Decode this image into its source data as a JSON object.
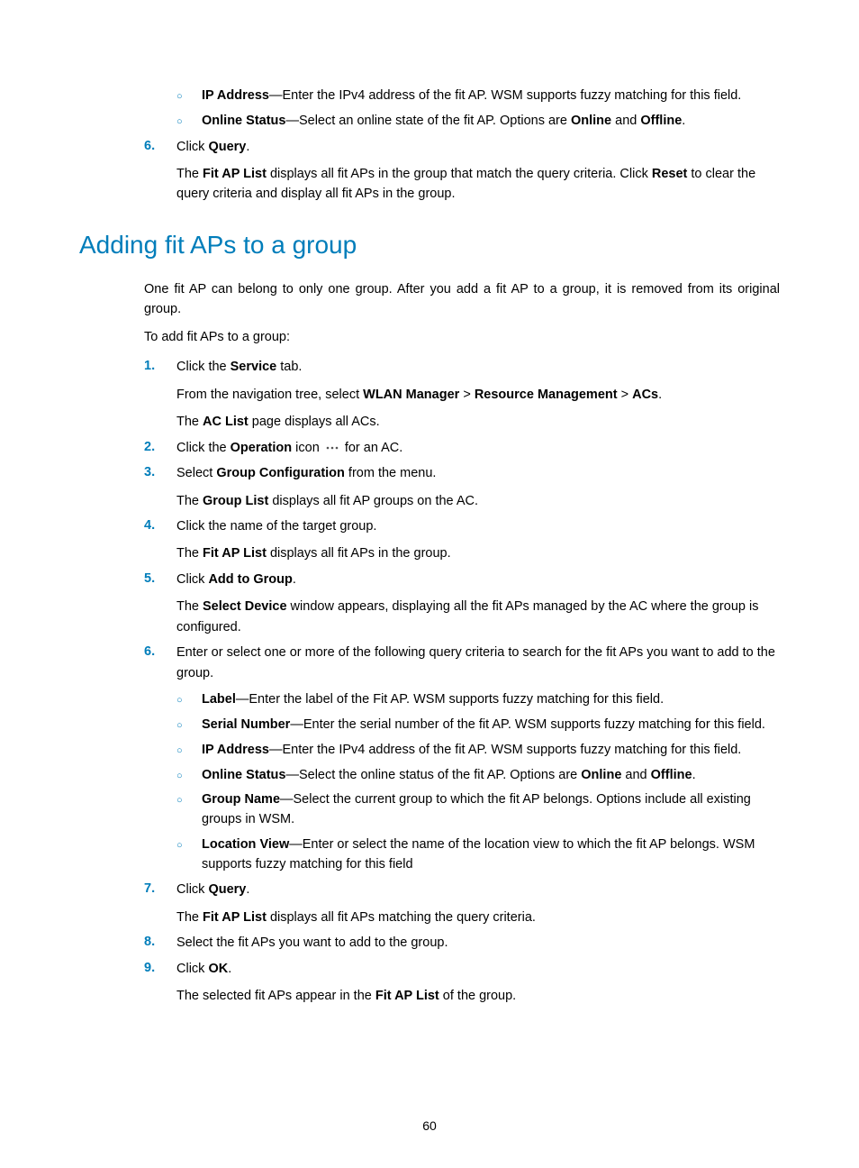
{
  "topBullets": [
    {
      "term": "IP Address",
      "desc": "—Enter the IPv4 address of the fit AP. WSM supports fuzzy matching for this field."
    },
    {
      "term": "Online Status",
      "desc_pre": "—Select an online state of the fit AP. Options are ",
      "opt1": "Online",
      "mid": " and ",
      "opt2": "Offline",
      "post": "."
    }
  ],
  "step6Top": {
    "num": "6.",
    "line_pre": "Click ",
    "line_bold": "Query",
    "line_post": ".",
    "follow_pre": "The ",
    "follow_b1": "Fit AP List",
    "follow_mid": " displays all fit APs in the group that match the query criteria. Click ",
    "follow_b2": "Reset",
    "follow_post": " to clear the query criteria and display all fit APs in the group."
  },
  "heading": "Adding fit APs to a group",
  "intro": "One fit AP can belong to only one group. After you add a fit AP to a group, it is removed from its original group.",
  "lead": "To add fit APs to a group:",
  "steps": [
    {
      "num": "1.",
      "line_pre": "Click the ",
      "line_bold": "Service",
      "line_post": " tab.",
      "follows": [
        {
          "pre": "From the navigation tree, select ",
          "b1": "WLAN Manager",
          "s1": " > ",
          "b2": "Resource Management",
          "s2": " > ",
          "b3": "ACs",
          "post": "."
        },
        {
          "pre": "The ",
          "b1": "AC List",
          "post": " page displays all ACs."
        }
      ]
    },
    {
      "num": "2.",
      "line_pre": "Click the ",
      "line_bold": "Operation",
      "line_mid": " icon ",
      "line_post": " for an AC.",
      "has_icon": true
    },
    {
      "num": "3.",
      "line_pre": "Select ",
      "line_bold": "Group Configuration",
      "line_post": " from the menu.",
      "follows": [
        {
          "pre": "The ",
          "b1": "Group List",
          "post": " displays all fit AP groups on the AC."
        }
      ]
    },
    {
      "num": "4.",
      "plain": "Click the name of the target group.",
      "follows": [
        {
          "pre": "The ",
          "b1": "Fit AP List",
          "post": " displays all fit APs in the group."
        }
      ]
    },
    {
      "num": "5.",
      "line_pre": "Click ",
      "line_bold": "Add to Group",
      "line_post": ".",
      "follows": [
        {
          "pre": "The ",
          "b1": "Select Device",
          "post": " window appears, displaying all the fit APs managed by the AC where the group is configured."
        }
      ]
    },
    {
      "num": "6.",
      "plain": "Enter or select one or more of the following query criteria to search for the fit APs you want to add to the group.",
      "bullets": [
        {
          "term": "Label",
          "desc": "—Enter the label of the Fit AP. WSM supports fuzzy matching for this field."
        },
        {
          "term": "Serial Number",
          "desc": "—Enter the serial number of the fit AP. WSM supports fuzzy matching for this field."
        },
        {
          "term": "IP Address",
          "desc": "—Enter the IPv4 address of the fit AP. WSM supports fuzzy matching for this field."
        },
        {
          "term": "Online Status",
          "desc_pre": "—Select the online status of the fit AP. Options are ",
          "opt1": "Online",
          "mid": " and ",
          "opt2": "Offline",
          "post": "."
        },
        {
          "term": "Group Name",
          "desc": "—Select the current group to which the fit AP belongs. Options include all existing groups in WSM."
        },
        {
          "term": "Location View",
          "desc": "—Enter or select the name of the location view to which the fit AP belongs. WSM supports fuzzy matching for this field"
        }
      ]
    },
    {
      "num": "7.",
      "line_pre": "Click ",
      "line_bold": "Query",
      "line_post": ".",
      "follows": [
        {
          "pre": "The ",
          "b1": "Fit AP List",
          "post": " displays all fit APs matching the query criteria."
        }
      ]
    },
    {
      "num": "8.",
      "plain": "Select the fit APs you want to add to the group."
    },
    {
      "num": "9.",
      "line_pre": "Click ",
      "line_bold": "OK",
      "line_post": ".",
      "follows": [
        {
          "pre": "The selected fit APs appear in the ",
          "b1": "Fit AP List",
          "post": " of the group."
        }
      ]
    }
  ],
  "pageNumber": "60"
}
